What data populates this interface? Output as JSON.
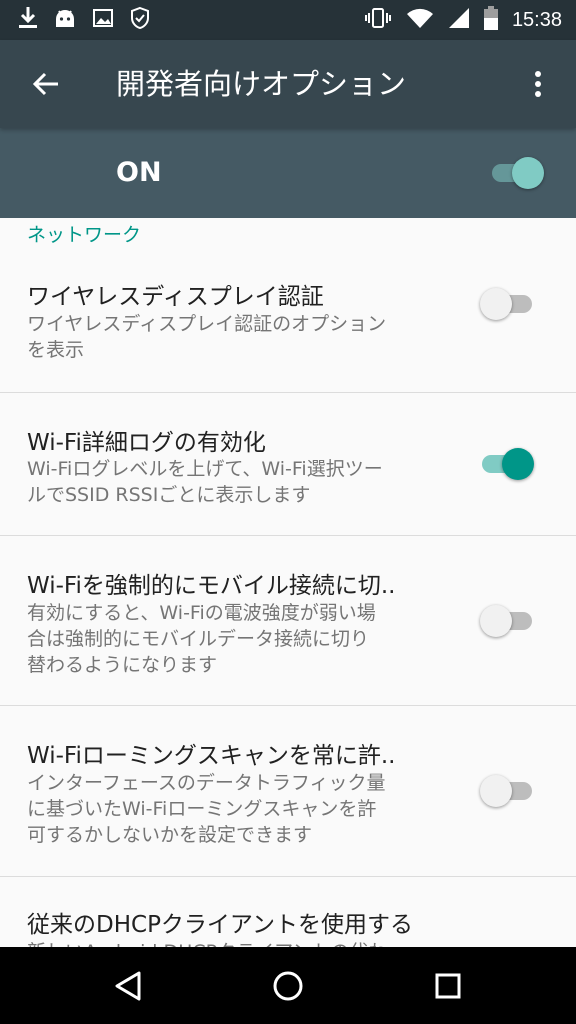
{
  "status_bar": {
    "time": "15:38",
    "left_icons": [
      "download-icon",
      "android-icon",
      "image-icon",
      "shield-check-icon"
    ],
    "right_icons": [
      "vibrate-icon",
      "wifi-icon",
      "cell-signal-icon",
      "battery-icon"
    ]
  },
  "app_bar": {
    "title": "開発者向けオプション",
    "back_icon": "arrow-back-icon",
    "menu_icon": "more-vert-icon"
  },
  "master_switch": {
    "label": "ON",
    "state": true
  },
  "colors": {
    "accent": "#009688",
    "appbar": "#37474f",
    "statusbar": "#263238",
    "master": "#455a64"
  },
  "category": {
    "label": "ネットワーク"
  },
  "prefs": [
    {
      "title": "ワイヤレスディスプレイ認証",
      "summary_lines": [
        "ワイヤレスディスプレイ認証のオプション",
        "を表示"
      ],
      "checked": false
    },
    {
      "title": "Wi-Fi詳細ログの有効化",
      "summary_lines": [
        "Wi-Fiログレベルを上げて、Wi-Fi選択ツー",
        "ルでSSID RSSIごとに表示します"
      ],
      "checked": true
    },
    {
      "title": "Wi-Fiを強制的にモバイル接続に切..",
      "summary_lines": [
        "有効にすると、Wi-Fiの電波強度が弱い場",
        "合は強制的にモバイルデータ接続に切り",
        "替わるようになります"
      ],
      "checked": false
    },
    {
      "title": "Wi-Fiローミングスキャンを常に許..",
      "summary_lines": [
        "インターフェースのデータトラフィック量",
        "に基づいたWi-Fiローミングスキャンを許",
        "可するかしないかを設定できます"
      ],
      "checked": false
    },
    {
      "title": "従来のDHCPクライアントを使用する",
      "summary_lines": [
        "新しいAndroid DHCPクライアントの代わ"
      ],
      "checked": false
    }
  ],
  "nav_bar": {
    "icons": [
      "back-triangle-icon",
      "home-circle-icon",
      "recents-square-icon"
    ]
  }
}
